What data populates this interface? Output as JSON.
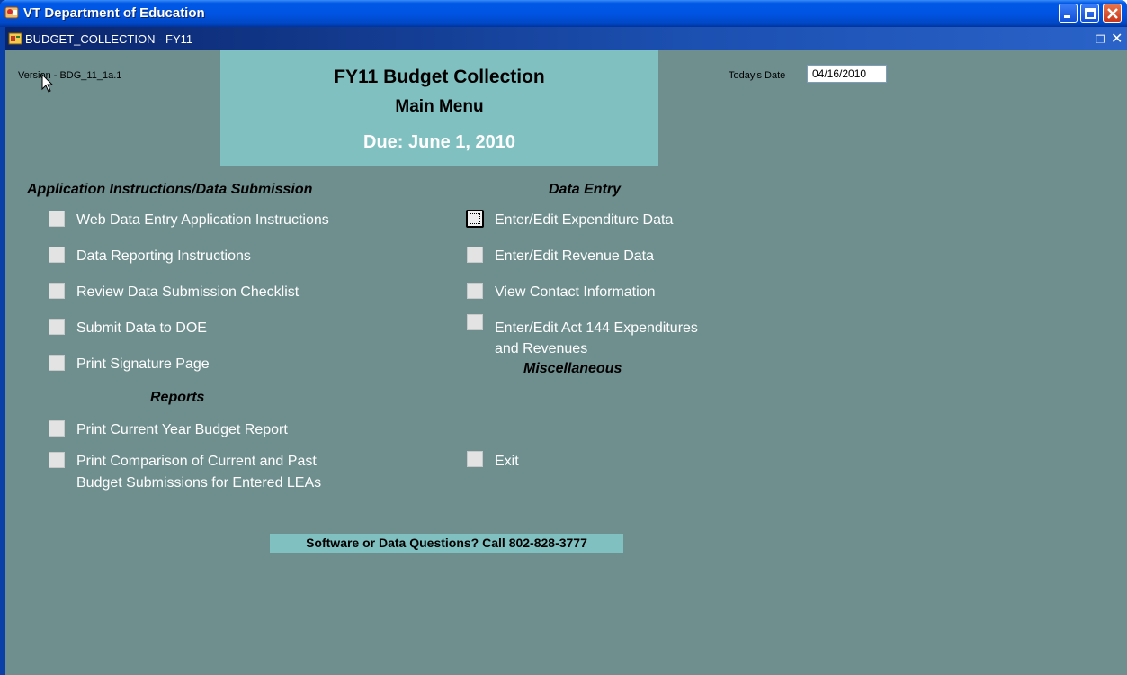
{
  "window": {
    "title": "VT Department of Education",
    "controls": {
      "minimize": "minimize-icon",
      "maximize": "maximize-icon",
      "close": "close-icon"
    }
  },
  "document": {
    "title": "BUDGET_COLLECTION - FY11"
  },
  "form": {
    "version": "Version - BDG_11_1a.1",
    "header": {
      "title": "FY11 Budget Collection",
      "subtitle": "Main Menu",
      "due": "Due:  June 1, 2010"
    },
    "todays_date_label": "Today's Date",
    "todays_date_value": "04/16/2010",
    "sections": {
      "instructions": {
        "heading": "Application Instructions/Data Submission",
        "items": [
          "Web Data Entry Application Instructions",
          "Data Reporting Instructions",
          "Review Data Submission Checklist",
          "Submit Data to DOE",
          "Print Signature Page"
        ]
      },
      "reports": {
        "heading": "Reports",
        "items": [
          "Print Current Year Budget Report",
          "Print Comparison of Current and Past",
          "Budget Submissions for Entered LEAs"
        ]
      },
      "data_entry": {
        "heading": "Data Entry",
        "items": [
          "Enter/Edit Expenditure Data",
          "Enter/Edit Revenue Data",
          "View Contact Information",
          "Enter/Edit Act 144 Expenditures",
          "and Revenues"
        ]
      },
      "misc": {
        "heading": "Miscellaneous",
        "items": [
          "Exit"
        ]
      }
    },
    "phone_banner": "Software or Data Questions?  Call 802-828-3777"
  },
  "colors": {
    "form_bg": "#6f8f8f",
    "header_bg": "#80c0c0",
    "label_text": "#ffffff"
  }
}
